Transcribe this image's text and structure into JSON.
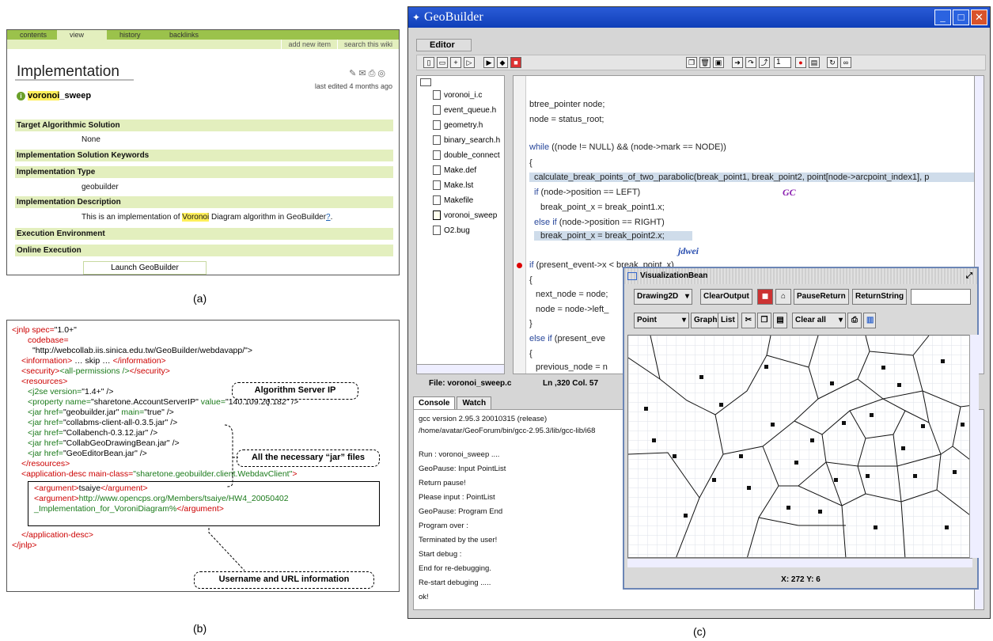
{
  "wiki": {
    "tabs": [
      "contents",
      "view",
      "history",
      "backlinks"
    ],
    "subtabs": [
      "add new item",
      "search this wiki"
    ],
    "title": "Implementation",
    "last_edited": "last edited 4 months ago",
    "page_name_part1": "voronoi",
    "page_name_part2": "_sweep",
    "rows": [
      {
        "label": "Target Algorithmic Solution",
        "value": "None"
      },
      {
        "label": "Implementation Solution Keywords",
        "value": ""
      },
      {
        "label": "Implementation Type",
        "value": "geobuilder"
      },
      {
        "label": "Implementation Description",
        "value_pre": "This is an implementation of ",
        "value_hl": "Voronoi",
        "value_post": " Diagram algorithm in GeoBuilder",
        "value_q": "?",
        "value_end": "."
      },
      {
        "label": "Execution Environment",
        "value": ""
      },
      {
        "label": "Online Execution",
        "value": ""
      }
    ],
    "launch_button": "Launch GeoBuilder"
  },
  "captions": {
    "a": "(a)",
    "b": "(b)",
    "c": "(c)"
  },
  "jnlp": {
    "callout_server": "Algorithm Server IP",
    "callout_jars": "All the necessary “jar” files",
    "callout_user": "Username and URL information",
    "l1a": "<jnlp spec=",
    "l1b": "\"1.0+\"",
    "l2": "codebase=",
    "l3": "\"http://webcollab.iis.sinica.edu.tw/GeoBuilder/webdavapp/\">",
    "l4a": "<information>",
    "l4b": " … skip … ",
    "l4c": "</information>",
    "l5a": "<security>",
    "l5b": "<all-permissions />",
    "l5c": "</security>",
    "l6": "<resources>",
    "l7a": "<j2se version=",
    "l7b": "\"1.4+\"",
    "l7c": " />",
    "l8a": "<property name=",
    "l8b": "\"sharetone.AccountServerIP\"",
    "l8c": " value=",
    "l8d": "\"140.109.20.182\"",
    "l8e": " />",
    "l9a": "<jar href=",
    "l9b": "\"geobuilder.jar\"",
    "l9c": " main=",
    "l9d": "\"true\"",
    "l9e": " />",
    "l10a": "<jar href=",
    "l10b": "\"collabms-client-all-0.3.5.jar\"",
    "l10c": " />",
    "l11a": "<jar href=",
    "l11b": "\"Collabench-0.3.12.jar\"",
    "l11c": " />",
    "l12a": "<jar href=",
    "l12b": "\"CollabGeoDrawingBean.jar\"",
    "l12c": " />",
    "l13a": "<jar href=",
    "l13b": "\"GeoEditorBean.jar\"",
    "l13c": " />",
    "l14": "</resources>",
    "l15a": "<application-desc main-class=",
    "l15b": "\"sharetone.geobuilder.client.WebdavClient\"",
    "l15c": ">",
    "l16a": "<argument>",
    "l16b": "tsaiye",
    "l16c": "</argument>",
    "l17a": "<argument>",
    "l17b": "http://www.opencps.org/Members/tsaiye/HW4_20050402",
    "l18a": "_Implementation_for_VoroniDiagram%",
    "l18b": "</argument>",
    "l19": "</application-desc>",
    "l20": "</jnlp>"
  },
  "geobuilder": {
    "window_title": "GeoBuilder",
    "editor_tab": "Editor",
    "toolbar_field": "1",
    "files": [
      "voronoi_i.c",
      "event_queue.h",
      "geometry.h",
      "binary_search.h",
      "double_connect",
      "Make.def",
      "Make.lst",
      "Makefile",
      "voronoi_sweep",
      "O2.bug"
    ],
    "code": {
      "c1": "btree_pointer node;",
      "c2": "node = status_root;",
      "c3a": "while",
      "c3b": " ((node != NULL) && (node->mark == NODE))",
      "c4": "{",
      "c5": "calculate_break_points_of_two_parabolic(break_point1, break_point2, point[node->arcpoint_index1], p",
      "c6a": "if",
      "c6b": " (node->position == LEFT)",
      "c7": "break_point_x = break_point1.x;",
      "c8a": "else if",
      "c8b": " (node->position == RIGHT)",
      "c9": "break_point_x = break_point2.x;",
      "c10a": "if",
      "c10b": " (present_event->x < break_point_x)",
      "c11": "{",
      "c12": "next_node = node;",
      "c13": "node = node->left_",
      "c14": "}",
      "c15a": "else if",
      "c15b": " (present_eve",
      "c16": "{",
      "c17": "previous_node = n"
    },
    "user_gc": "GC",
    "user_jdwei": "jdwei",
    "status_file": "File: voronoi_sweep.c",
    "status_pos": "Ln ,320 Col. 57",
    "console_tabs": [
      "Console",
      "Watch"
    ],
    "console_lines": [
      "gcc version 2.95.3 20010315 (release)",
      "/home/avatar/GeoForum/bin/gcc-2.95.3/lib/gcc-lib/i68",
      "",
      "Run : voronoi_sweep ....",
      "GeoPause: Input PointList",
      "Return pause!",
      "Please input : PointList",
      "GeoPause: Program End",
      "Program over :",
      "Terminated by the user!",
      "Start debug :",
      "End for re-debugging.",
      "Re-start debuging .....",
      "ok!"
    ],
    "viz": {
      "title": "VisualizationBean",
      "b_drawing": "Drawing2D",
      "b_clearout": "ClearOutput",
      "b_pausereturn": "PauseReturn",
      "b_returnstring": "ReturnString",
      "b_point": "Point",
      "b_graph": "Graph",
      "b_list": "List",
      "b_clearall": "Clear all",
      "coord": "X: 272  Y: 6"
    }
  }
}
